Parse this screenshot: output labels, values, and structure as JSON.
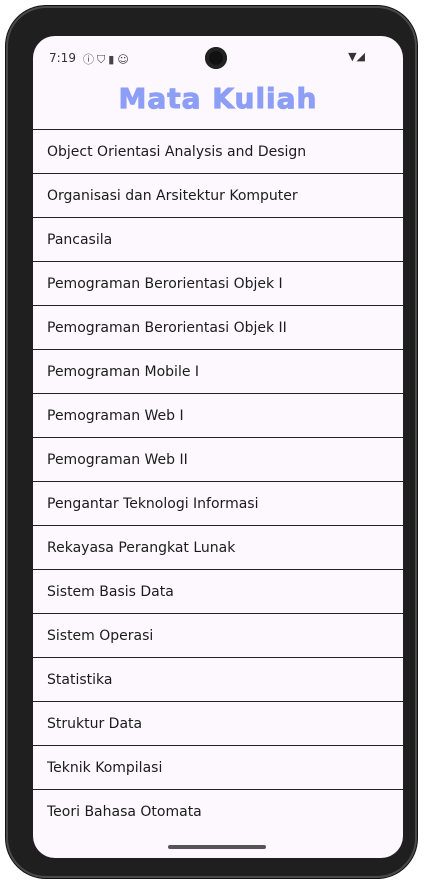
{
  "status_bar": {
    "time": "7:19",
    "left_icons": [
      "info-icon",
      "shield-icon",
      "sd-card-icon",
      "face-icon"
    ],
    "right_icons": [
      "wifi-icon",
      "signal-icon"
    ]
  },
  "title": "Mata Kuliah",
  "colors": {
    "title": "#8c9ef5",
    "background": "#fdf7fe",
    "divider": "#222222"
  },
  "courses": [
    "Object Orientasi Analysis and Design",
    "Organisasi dan Arsitektur Komputer",
    "Pancasila",
    "Pemograman Berorientasi Objek I",
    "Pemograman Berorientasi Objek II",
    "Pemograman Mobile I",
    "Pemograman Web I",
    "Pemograman Web II",
    "Pengantar Teknologi Informasi",
    "Rekayasa Perangkat Lunak",
    "Sistem Basis Data",
    "Sistem Operasi",
    "Statistika",
    "Struktur Data",
    "Teknik Kompilasi",
    "Teori Bahasa Otomata"
  ]
}
